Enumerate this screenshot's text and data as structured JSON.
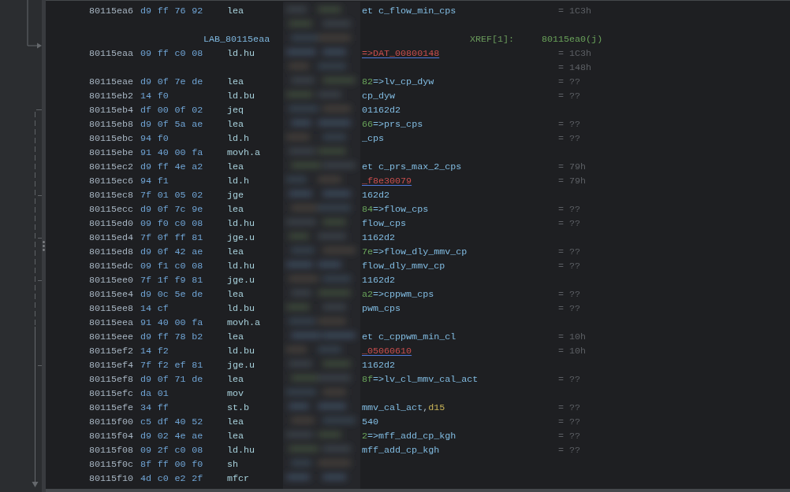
{
  "listing": {
    "rows": [
      {
        "kind": "instruction",
        "address": "80115ea6",
        "bytes": "d9 ff 76 92",
        "mnemonic": "lea",
        "operand": [
          {
            "kind": "ref",
            "text": "et c_flow_min_cps"
          }
        ],
        "value": "= 1C3h"
      },
      {
        "kind": "blank"
      },
      {
        "kind": "label",
        "label": "LAB_80115eaa",
        "xref_label": "XREF[1]:",
        "xref": "80115ea0(j)"
      },
      {
        "kind": "instruction",
        "address": "80115eaa",
        "bytes": "09 ff c0 08",
        "mnemonic": "ld.hu",
        "operand": [
          {
            "kind": "data",
            "text": "=>DAT_00800148"
          }
        ],
        "value": "= 1C3h"
      },
      {
        "kind": "value",
        "value": "= 148h"
      },
      {
        "kind": "instruction",
        "address": "80115eae",
        "bytes": "d9 0f 7e de",
        "mnemonic": "lea",
        "operand": [
          {
            "kind": "addr",
            "text": "82"
          },
          {
            "kind": "ref",
            "text": "=>lv_cp_dyw"
          }
        ],
        "value": "= ??"
      },
      {
        "kind": "instruction",
        "address": "80115eb2",
        "bytes": "14 f0",
        "mnemonic": "ld.bu",
        "operand": [
          {
            "kind": "ref",
            "text": "cp_dyw"
          }
        ],
        "value": "= ??"
      },
      {
        "kind": "instruction",
        "address": "80115eb4",
        "bytes": "df 00 0f 02",
        "mnemonic": "jeq",
        "operand": [
          {
            "kind": "ref",
            "text": "01162d2"
          }
        ]
      },
      {
        "kind": "instruction",
        "address": "80115eb8",
        "bytes": "d9 0f 5a ae",
        "mnemonic": "lea",
        "operand": [
          {
            "kind": "addr",
            "text": "66"
          },
          {
            "kind": "ref",
            "text": "=>prs_cps"
          }
        ],
        "value": "= ??"
      },
      {
        "kind": "instruction",
        "address": "80115ebc",
        "bytes": "94 f0",
        "mnemonic": "ld.h",
        "operand": [
          {
            "kind": "ref",
            "text": "_cps"
          }
        ],
        "value": "= ??"
      },
      {
        "kind": "instruction",
        "address": "80115ebe",
        "bytes": "91 40 00 fa",
        "mnemonic": "movh.a"
      },
      {
        "kind": "instruction",
        "address": "80115ec2",
        "bytes": "d9 ff 4e a2",
        "mnemonic": "lea",
        "operand": [
          {
            "kind": "ref",
            "text": "et c_prs_max_2_cps"
          }
        ],
        "value": "= 79h"
      },
      {
        "kind": "instruction",
        "address": "80115ec6",
        "bytes": "94 f1",
        "mnemonic": "ld.h",
        "operand": [
          {
            "kind": "data",
            "text": "_f8e30079"
          }
        ],
        "value": "= 79h"
      },
      {
        "kind": "instruction",
        "address": "80115ec8",
        "bytes": "7f 01 05 02",
        "mnemonic": "jge",
        "operand": [
          {
            "kind": "ref",
            "text": "162d2"
          }
        ]
      },
      {
        "kind": "instruction",
        "address": "80115ecc",
        "bytes": "d9 0f 7c 9e",
        "mnemonic": "lea",
        "operand": [
          {
            "kind": "addr",
            "text": "84"
          },
          {
            "kind": "ref",
            "text": "=>flow_cps"
          }
        ],
        "value": "= ??"
      },
      {
        "kind": "instruction",
        "address": "80115ed0",
        "bytes": "09 f0 c0 08",
        "mnemonic": "ld.hu",
        "operand": [
          {
            "kind": "ref",
            "text": "flow_cps"
          }
        ],
        "value": "= ??"
      },
      {
        "kind": "instruction",
        "address": "80115ed4",
        "bytes": "7f 0f ff 81",
        "mnemonic": "jge.u",
        "operand": [
          {
            "kind": "ref",
            "text": "1162d2"
          }
        ]
      },
      {
        "kind": "instruction",
        "address": "80115ed8",
        "bytes": "d9 0f 42 ae",
        "mnemonic": "lea",
        "operand": [
          {
            "kind": "addr",
            "text": "7e"
          },
          {
            "kind": "ref",
            "text": "=>flow_dly_mmv_cp"
          }
        ],
        "value": "= ??"
      },
      {
        "kind": "instruction",
        "address": "80115edc",
        "bytes": "09 f1 c0 08",
        "mnemonic": "ld.hu",
        "operand": [
          {
            "kind": "ref",
            "text": "flow_dly_mmv_cp"
          }
        ],
        "value": "= ??"
      },
      {
        "kind": "instruction",
        "address": "80115ee0",
        "bytes": "7f 1f f9 81",
        "mnemonic": "jge.u",
        "operand": [
          {
            "kind": "ref",
            "text": "1162d2"
          }
        ]
      },
      {
        "kind": "instruction",
        "address": "80115ee4",
        "bytes": "d9 0c 5e de",
        "mnemonic": "lea",
        "operand": [
          {
            "kind": "addr",
            "text": "a2"
          },
          {
            "kind": "ref",
            "text": "=>cppwm_cps"
          }
        ],
        "value": "= ??"
      },
      {
        "kind": "instruction",
        "address": "80115ee8",
        "bytes": "14 cf",
        "mnemonic": "ld.bu",
        "operand": [
          {
            "kind": "ref",
            "text": "pwm_cps"
          }
        ],
        "value": "= ??"
      },
      {
        "kind": "instruction",
        "address": "80115eea",
        "bytes": "91 40 00 fa",
        "mnemonic": "movh.a"
      },
      {
        "kind": "instruction",
        "address": "80115eee",
        "bytes": "d9 ff 78 b2",
        "mnemonic": "lea",
        "operand": [
          {
            "kind": "ref",
            "text": "et c_cppwm_min_cl"
          }
        ],
        "value": "= 10h"
      },
      {
        "kind": "instruction",
        "address": "80115ef2",
        "bytes": "14 f2",
        "mnemonic": "ld.bu",
        "operand": [
          {
            "kind": "data",
            "text": "_05060610"
          }
        ],
        "value": "= 10h"
      },
      {
        "kind": "instruction",
        "address": "80115ef4",
        "bytes": "7f f2 ef 81",
        "mnemonic": "jge.u",
        "operand": [
          {
            "kind": "ref",
            "text": "1162d2"
          }
        ]
      },
      {
        "kind": "instruction",
        "address": "80115ef8",
        "bytes": "d9 0f 71 de",
        "mnemonic": "lea",
        "operand": [
          {
            "kind": "addr",
            "text": "8f"
          },
          {
            "kind": "ref",
            "text": "=>lv_cl_mmv_cal_act"
          }
        ],
        "value": "= ??"
      },
      {
        "kind": "instruction",
        "address": "80115efc",
        "bytes": "da 01",
        "mnemonic": "mov"
      },
      {
        "kind": "instruction",
        "address": "80115efe",
        "bytes": "34 ff",
        "mnemonic": "st.b",
        "operand": [
          {
            "kind": "ref",
            "text": "mmv_cal_act"
          },
          {
            "kind": "punct",
            "text": ","
          },
          {
            "kind": "reg",
            "text": "d15"
          }
        ],
        "value": "= ??"
      },
      {
        "kind": "instruction",
        "address": "80115f00",
        "bytes": "c5 df 40 52",
        "mnemonic": "lea",
        "operand": [
          {
            "kind": "ref",
            "text": "540"
          }
        ],
        "value": "= ??"
      },
      {
        "kind": "instruction",
        "address": "80115f04",
        "bytes": "d9 02 4e ae",
        "mnemonic": "lea",
        "operand": [
          {
            "kind": "addr",
            "text": "2"
          },
          {
            "kind": "ref",
            "text": "=>mff_add_cp_kgh"
          }
        ],
        "value": "= ??"
      },
      {
        "kind": "instruction",
        "address": "80115f08",
        "bytes": "09 2f c0 08",
        "mnemonic": "ld.hu",
        "operand": [
          {
            "kind": "ref",
            "text": "mff_add_cp_kgh"
          }
        ],
        "value": "= ??"
      },
      {
        "kind": "instruction",
        "address": "80115f0c",
        "bytes": "8f ff 00 f0",
        "mnemonic": "sh"
      },
      {
        "kind": "instruction",
        "address": "80115f10",
        "bytes": "4d c0 e2 2f",
        "mnemonic": "mfcr"
      }
    ]
  }
}
